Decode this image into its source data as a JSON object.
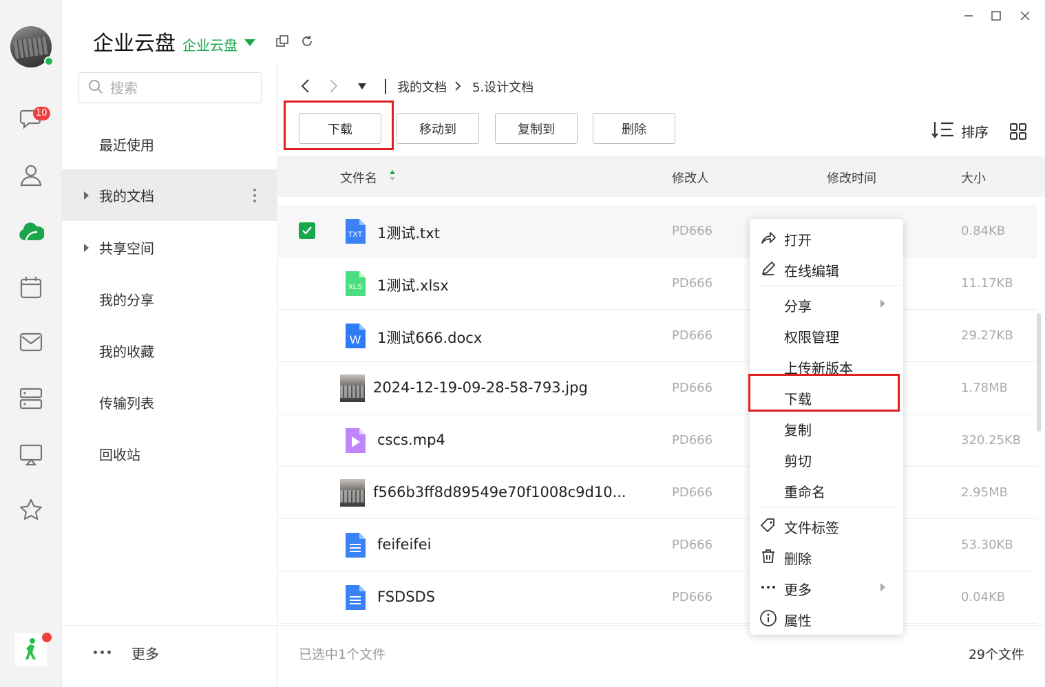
{
  "app": {
    "title": "企业云盘",
    "space": "企业云盘"
  },
  "rail": {
    "chat_badge": "10"
  },
  "nav": {
    "search_placeholder": "搜索",
    "items": [
      {
        "label": "最近使用"
      },
      {
        "label": "我的文档"
      },
      {
        "label": "共享空间"
      },
      {
        "label": "我的分享"
      },
      {
        "label": "我的收藏"
      },
      {
        "label": "传输列表"
      },
      {
        "label": "回收站"
      }
    ],
    "more_label": "更多"
  },
  "breadcrumb": {
    "root": "我的文档",
    "current": "5.设计文档"
  },
  "toolbar": {
    "download": "下载",
    "move_to": "移动到",
    "copy_to": "复制到",
    "delete": "删除",
    "sort": "排序"
  },
  "table": {
    "headers": {
      "name": "文件名",
      "modifier": "修改人",
      "modified_time": "修改时间",
      "size": "大小"
    },
    "rows": [
      {
        "name": "1测试.txt",
        "type": "txt",
        "icon_text": "TXT",
        "modifier": "PD666",
        "size": "0.84KB",
        "selected": true
      },
      {
        "name": "1测试.xlsx",
        "type": "xls",
        "icon_text": "XLS",
        "modifier": "PD666",
        "size": "11.17KB",
        "selected": false
      },
      {
        "name": "1测试666.docx",
        "type": "doc",
        "icon_text": "W",
        "modifier": "PD666",
        "size": "29.27KB",
        "selected": false
      },
      {
        "name": "2024-12-19-09-28-58-793.jpg",
        "type": "image",
        "modifier": "PD666",
        "size": "1.78MB",
        "selected": false
      },
      {
        "name": "cscs.mp4",
        "type": "video",
        "modifier": "PD666",
        "size": "320.25KB",
        "selected": false
      },
      {
        "name": "f566b3ff8d89549e70f1008c9d10...",
        "type": "image",
        "modifier": "PD666",
        "size": "2.95MB",
        "selected": false
      },
      {
        "name": "feifeifei",
        "type": "gdoc",
        "modifier": "PD666",
        "size": "53.30KB",
        "selected": false
      },
      {
        "name": "FSDSDS",
        "type": "gdoc",
        "modifier": "PD666",
        "size": "0.04KB",
        "selected": false
      }
    ]
  },
  "context_menu": {
    "items": [
      {
        "label": "打开",
        "icon": "open-icon"
      },
      {
        "label": "在线编辑",
        "icon": "pencil-icon"
      },
      {
        "label": "分享",
        "icon": ""
      },
      {
        "label": "权限管理",
        "icon": ""
      },
      {
        "label": "上传新版本",
        "icon": ""
      },
      {
        "label": "下载",
        "icon": ""
      },
      {
        "label": "复制",
        "icon": ""
      },
      {
        "label": "剪切",
        "icon": ""
      },
      {
        "label": "重命名",
        "icon": ""
      },
      {
        "label": "文件标签",
        "icon": "tag-icon"
      },
      {
        "label": "删除",
        "icon": "trash-icon"
      },
      {
        "label": "更多",
        "icon": "more-dots-icon"
      },
      {
        "label": "属性",
        "icon": "info-icon"
      }
    ]
  },
  "status": {
    "selected_text": "已选中1个文件",
    "total_text": "29个文件"
  },
  "colors": {
    "accent_green": "#1aa64a",
    "highlight_red": "#e02020",
    "badge_red": "#f04040",
    "doc_blue": "#3b82f6"
  }
}
